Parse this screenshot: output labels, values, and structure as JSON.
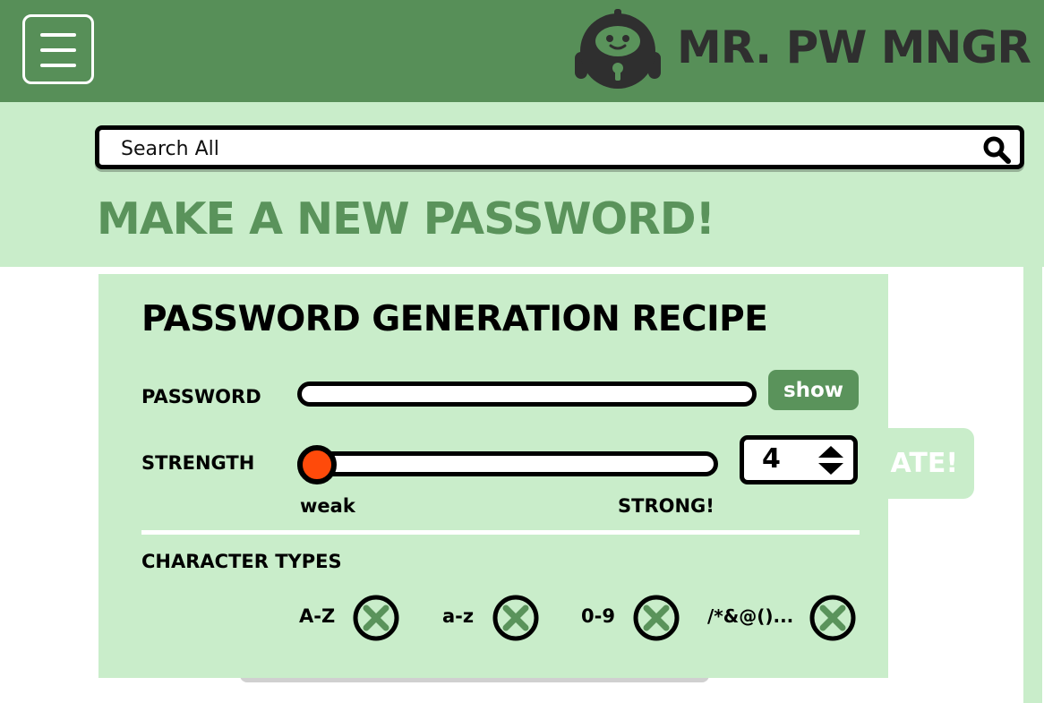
{
  "header": {
    "brand": "MR. PW MNGR",
    "logo_icon": "robot-lock-icon",
    "menu_icon": "hamburger-menu-icon",
    "colors": {
      "header_bg": "#578f58",
      "brand_text": "#2f2f2f"
    }
  },
  "search": {
    "placeholder": "Search All",
    "icon": "search-icon"
  },
  "page": {
    "title": "MAKE A NEW PASSWORD!",
    "colors": {
      "title": "#5a935b",
      "light_bg": "#c9edca"
    }
  },
  "generate_button": {
    "label_visible": "ATE!"
  },
  "recipe": {
    "title": "PASSWORD GENERATION RECIPE",
    "password_label": "PASSWORD",
    "password_value": "",
    "show_label": "show",
    "strength_label": "STRENGTH",
    "strength_min_label": "weak",
    "strength_max_label": "STRONG!",
    "strength_value": 4,
    "strength_level": 0,
    "knob_color": "#ff4a0a",
    "character_types_label": "CHARACTER TYPES",
    "character_types": [
      {
        "label": "A-Z",
        "icon": "x-circle-icon"
      },
      {
        "label": "a-z",
        "icon": "x-circle-icon"
      },
      {
        "label": "0-9",
        "icon": "x-circle-icon"
      },
      {
        "label": "/*&@()...",
        "icon": "x-circle-icon"
      }
    ]
  }
}
